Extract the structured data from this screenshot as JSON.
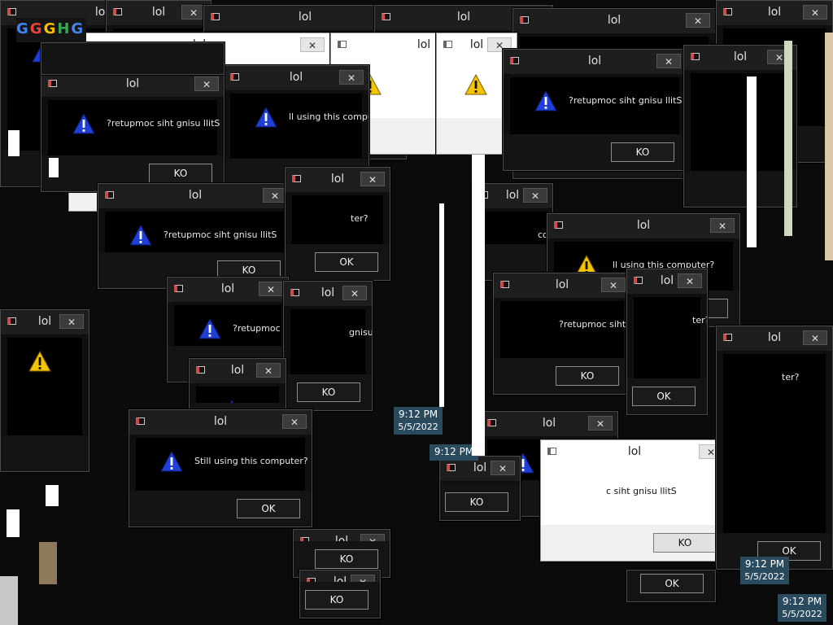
{
  "dialog_title": "lol",
  "message": "Still using this computer?",
  "message_mirrored": "?retupmoc siht gnisu llitS",
  "message_mirrored_cut": "c siht gnisu llitS",
  "message_partial_a": "Still using this",
  "message_partial_b": "ll using this computer?",
  "message_partial_c": "computer?",
  "message_partial_d": "ter?",
  "message_partial_e": "gnisu llitS",
  "message_partial_f": "?retupmoc siht g",
  "message_partial_g": "Still using this computer?",
  "ok_label": "OK",
  "ko_label": "KO",
  "close_glyph": "✕",
  "clock": {
    "time": "9:12 PM",
    "date": "5/5/2022"
  },
  "logo_glyphs": [
    "G",
    "G",
    "G",
    "H",
    "G"
  ],
  "colors": {
    "warn_blue": "#1f3fd6",
    "warn_yellow": "#f3c400",
    "clock_bg": "#2a4a5e"
  },
  "windows": [
    {
      "l": 0,
      "t": 0,
      "w": 250,
      "h": 230,
      "theme": "dark",
      "text": "message_partial_a",
      "btn": "ko_label",
      "icon": "blue"
    },
    {
      "l": 130,
      "t": 0,
      "w": 130,
      "h": 100,
      "theme": "dark",
      "text": "",
      "btn": "",
      "icon": ""
    },
    {
      "l": 250,
      "t": 6,
      "w": 250,
      "h": 190,
      "theme": "dark",
      "text": "",
      "btn": "ok_label",
      "icon": ""
    },
    {
      "l": 460,
      "t": 6,
      "w": 220,
      "h": 110,
      "theme": "dark",
      "text": "",
      "btn": "",
      "icon": ""
    },
    {
      "l": 630,
      "t": 10,
      "w": 250,
      "h": 210,
      "theme": "dark",
      "text": "",
      "btn": "ko_label",
      "icon": ""
    },
    {
      "l": 880,
      "t": 0,
      "w": 144,
      "h": 200,
      "theme": "dark",
      "text": "",
      "btn": "",
      "icon": ""
    },
    {
      "l": 84,
      "t": 40,
      "w": 322,
      "h": 220,
      "theme": "light",
      "text": "message_partial_c",
      "btn": "ok_label",
      "icon": "yellow"
    },
    {
      "l": 406,
      "t": 40,
      "w": 230,
      "h": 150,
      "theme": "light",
      "text": "",
      "btn": "ok_label",
      "icon": "yellow"
    },
    {
      "l": 536,
      "t": 40,
      "w": 100,
      "h": 150,
      "theme": "light",
      "text": "",
      "btn": "",
      "icon": "yellow"
    },
    {
      "l": 274,
      "t": 80,
      "w": 180,
      "h": 160,
      "theme": "dark",
      "text": "message_partial_b",
      "btn": "",
      "icon": "blue"
    },
    {
      "l": 618,
      "t": 60,
      "w": 226,
      "h": 150,
      "theme": "dark",
      "text": "message_mirrored",
      "btn": "ko_label",
      "icon": "blue"
    },
    {
      "l": 840,
      "t": 55,
      "w": 140,
      "h": 200,
      "theme": "dark",
      "text": "",
      "btn": "",
      "icon": ""
    },
    {
      "l": 50,
      "t": 88,
      "w": 226,
      "h": 148,
      "theme": "dark",
      "text": "message_mirrored",
      "btn": "ko_label",
      "icon": "blue"
    },
    {
      "l": 50,
      "t": 52,
      "w": 226,
      "h": 40,
      "theme": "dark",
      "text": "",
      "btn": "",
      "icon": ""
    },
    {
      "l": 120,
      "t": 225,
      "w": 240,
      "h": 130,
      "theme": "dark",
      "text": "message_mirrored",
      "btn": "ko_label",
      "icon": "blue"
    },
    {
      "l": 350,
      "t": 205,
      "w": 130,
      "h": 140,
      "theme": "dark",
      "text": "message_partial_d",
      "btn": "ok_label",
      "icon": ""
    },
    {
      "l": 580,
      "t": 225,
      "w": 100,
      "h": 120,
      "theme": "dark",
      "text": "message_partial_c",
      "btn": "",
      "icon": ""
    },
    {
      "l": 672,
      "t": 262,
      "w": 238,
      "h": 140,
      "theme": "dark",
      "text": "message_partial_b",
      "btn": "ok_label",
      "icon": "yellow"
    },
    {
      "l": 606,
      "t": 335,
      "w": 170,
      "h": 150,
      "theme": "dark",
      "text": "message_mirrored",
      "btn": "ko_label",
      "icon": ""
    },
    {
      "l": 770,
      "t": 330,
      "w": 100,
      "h": 180,
      "theme": "dark",
      "text": "message_partial_d",
      "btn": "ok_label",
      "icon": ""
    },
    {
      "l": 205,
      "t": 340,
      "w": 150,
      "h": 130,
      "theme": "dark",
      "text": "message_partial_f",
      "btn": "",
      "icon": "blue"
    },
    {
      "l": 348,
      "t": 345,
      "w": 110,
      "h": 160,
      "theme": "dark",
      "text": "message_partial_e",
      "btn": "ko_label",
      "icon": ""
    },
    {
      "l": 0,
      "t": 380,
      "w": 110,
      "h": 200,
      "theme": "dark",
      "text": "",
      "btn": "",
      "icon": "yellow"
    },
    {
      "l": 232,
      "t": 440,
      "w": 120,
      "h": 100,
      "theme": "dark",
      "text": "message_partial_a",
      "btn": "",
      "icon": "blue"
    },
    {
      "l": 158,
      "t": 503,
      "w": 226,
      "h": 145,
      "theme": "dark",
      "text": "message_partial_g",
      "btn": "ok_label",
      "icon": "blue"
    },
    {
      "l": 590,
      "t": 505,
      "w": 170,
      "h": 130,
      "theme": "dark",
      "text": "message_mirrored",
      "btn": "",
      "icon": "blue"
    },
    {
      "l": 540,
      "t": 560,
      "w": 100,
      "h": 80,
      "theme": "dark",
      "text": "",
      "btn": "ko_label",
      "icon": ""
    },
    {
      "l": 664,
      "t": 540,
      "w": 232,
      "h": 150,
      "theme": "light",
      "text": "message_mirrored_cut",
      "btn": "ko_label",
      "icon": ""
    },
    {
      "l": 880,
      "t": 400,
      "w": 144,
      "h": 300,
      "theme": "dark",
      "text": "message_partial_d",
      "btn": "ok_label",
      "icon": ""
    },
    {
      "l": 360,
      "t": 650,
      "w": 120,
      "h": 60,
      "theme": "dark",
      "text": "",
      "btn": "ko_label",
      "icon": ""
    },
    {
      "l": 368,
      "t": 700,
      "w": 100,
      "h": 60,
      "theme": "dark",
      "text": "",
      "btn": "ko_label",
      "icon": ""
    },
    {
      "l": 770,
      "t": 700,
      "w": 110,
      "h": 40,
      "theme": "dark",
      "text": "",
      "btn": "ok_label",
      "icon": ""
    }
  ]
}
